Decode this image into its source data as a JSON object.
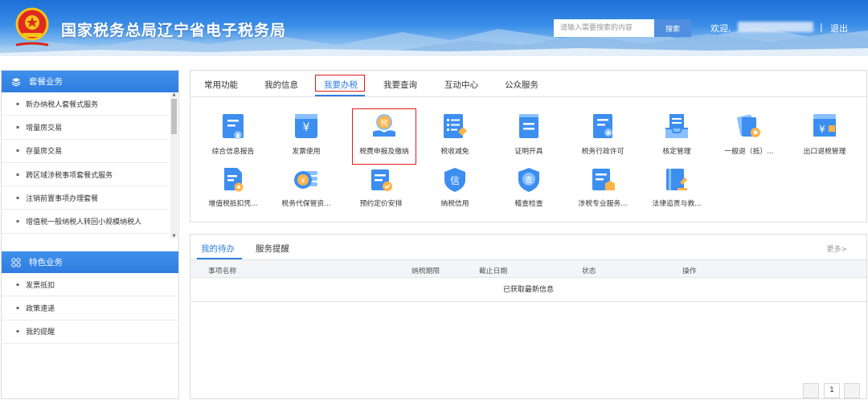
{
  "header": {
    "site_title": "国家税务总局辽宁省电子税务局",
    "search_placeholder": "请输入需要搜索的内容",
    "search_button": "搜索",
    "welcome": "欢迎,",
    "separator": "|",
    "logout": "退出"
  },
  "sidebar": {
    "section1_title": "套餐业务",
    "section1_items": [
      "新办纳税人套餐式服务",
      "增量房交易",
      "存量房交易",
      "跨区域涉税事项套餐式服务",
      "注销前置事项办理套餐",
      "增值税一般纳税人转回小规模纳税人"
    ],
    "section2_title": "特色业务",
    "section2_items": [
      "发票抵扣",
      "政策速递",
      "我的提醒"
    ]
  },
  "main_tabs": [
    "常用功能",
    "我的信息",
    "我要办税",
    "我要查询",
    "互动中心",
    "公众服务"
  ],
  "functions_row1": [
    "综合信息报告",
    "发票使用",
    "税费申报及缴纳",
    "税收减免",
    "证明开具",
    "税务行政许可",
    "核定管理",
    "一般退（抵）...",
    "出口退税管理"
  ],
  "functions_row2": [
    "增值税抵扣凭...",
    "税务代保管资...",
    "预约定价安排",
    "纳税信用",
    "稽查检查",
    "涉税专业服务...",
    "法律追责与救..."
  ],
  "icon_glyphs": {
    "tax_coin": "税",
    "credit": "信",
    "audit": "查",
    "yuan": "¥"
  },
  "todo": {
    "tabs": [
      "我的待办",
      "服务提醒"
    ],
    "more": "更多>",
    "columns": [
      "事项名称",
      "纳税期限",
      "截止日期",
      "状态",
      "操作"
    ],
    "empty_message": "已获取最新信息",
    "page": "1"
  },
  "colors": {
    "brand_blue": "#2f7de0",
    "highlight_red": "#e21b1b",
    "header_blue": "#1d6fd6"
  }
}
